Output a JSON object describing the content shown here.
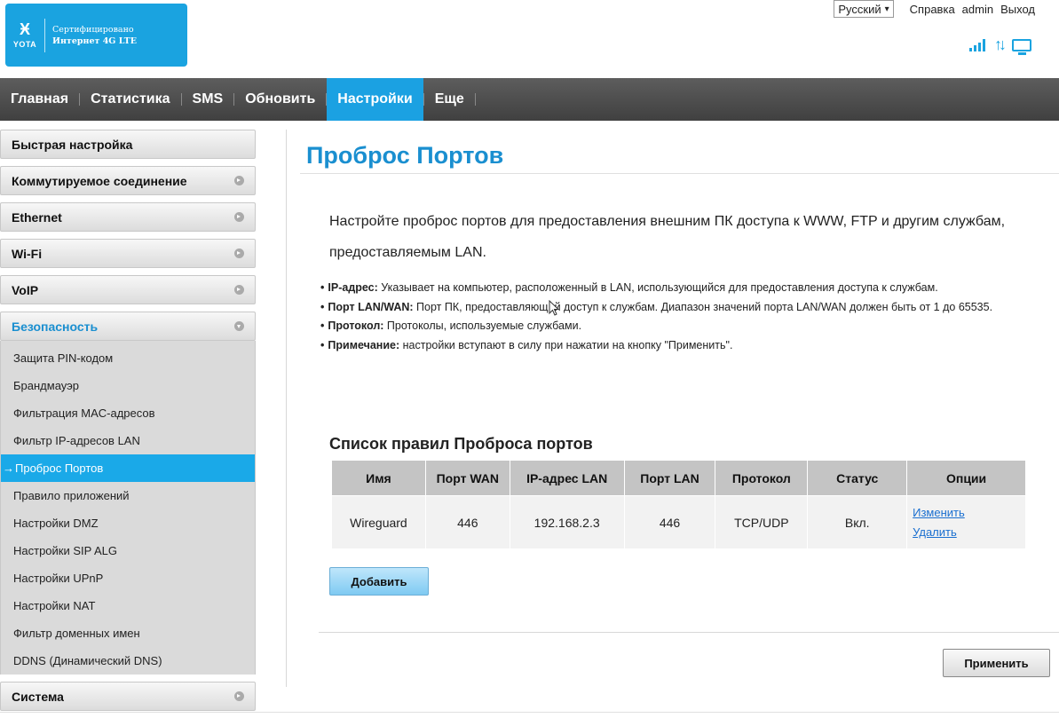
{
  "header": {
    "logo_line1": "Сертифицировано",
    "logo_line2": "Интернет 4G LTE",
    "logo_brand": "YOTA",
    "language": "Русский",
    "help": "Справка",
    "user": "admin",
    "logout": "Выход",
    "icons": [
      "signal-icon",
      "data-transfer-icon",
      "connection-monitor-icon"
    ],
    "accent": "#1aa3e0"
  },
  "nav": {
    "items": [
      {
        "label": "Главная"
      },
      {
        "label": "Статистика"
      },
      {
        "label": "SMS"
      },
      {
        "label": "Обновить"
      },
      {
        "label": "Настройки"
      },
      {
        "label": "Еще"
      }
    ],
    "active": "Настройки"
  },
  "sidebar": {
    "groups": [
      {
        "label": "Быстрая настройка"
      },
      {
        "label": "Коммутируемое соединение"
      },
      {
        "label": "Ethernet"
      },
      {
        "label": "Wi-Fi"
      },
      {
        "label": "VoIP"
      },
      {
        "label": "Безопасность"
      },
      {
        "label": "Система"
      }
    ],
    "security_items": [
      {
        "label": "Защита PIN-кодом"
      },
      {
        "label": "Брандмауэр"
      },
      {
        "label": "Фильтрация MAC-адресов"
      },
      {
        "label": "Фильтр IP-адресов LAN"
      },
      {
        "label": "Проброс Портов"
      },
      {
        "label": "Правило приложений"
      },
      {
        "label": "Настройки DMZ"
      },
      {
        "label": "Настройки SIP ALG"
      },
      {
        "label": "Настройки UPnP"
      },
      {
        "label": "Настройки NAT"
      },
      {
        "label": "Фильтр доменных имен"
      },
      {
        "label": "DDNS (Динамический DNS)"
      }
    ]
  },
  "main": {
    "title": "Проброс Портов",
    "intro": "Настройте проброс портов для предоставления внешним ПК доступа к WWW, FTP и другим службам, предоставляемым LAN.",
    "bullets": [
      {
        "term": "IP-адрес:",
        "text": " Указывает на компьютер, расположенный в LAN, использующийся для предоставления доступа к службам."
      },
      {
        "term": "Порт LAN/WAN:",
        "text": " Порт ПК, предоставляющий доступ к службам. Диапазон значений порта LAN/WAN должен быть от 1 до 65535."
      },
      {
        "term": "Протокол:",
        "text": " Протоколы, используемые службами."
      },
      {
        "term": "Примечание:",
        "text": " настройки вступают в силу при нажатии на кнопку \"Применить\"."
      }
    ],
    "list_title": "Список правил Проброса портов",
    "table": {
      "headers": [
        "Имя",
        "Порт WAN",
        "IP-адрес LAN",
        "Порт LAN",
        "Протокол",
        "Статус",
        "Опции"
      ],
      "rows": [
        {
          "name": "Wireguard",
          "wan_port": "446",
          "lan_ip": "192.168.2.3",
          "lan_port": "446",
          "protocol": "TCP/UDP",
          "status": "Вкл.",
          "edit": "Изменить",
          "delete": "Удалить"
        }
      ]
    },
    "add_label": "Добавить",
    "apply_label": "Применить"
  }
}
